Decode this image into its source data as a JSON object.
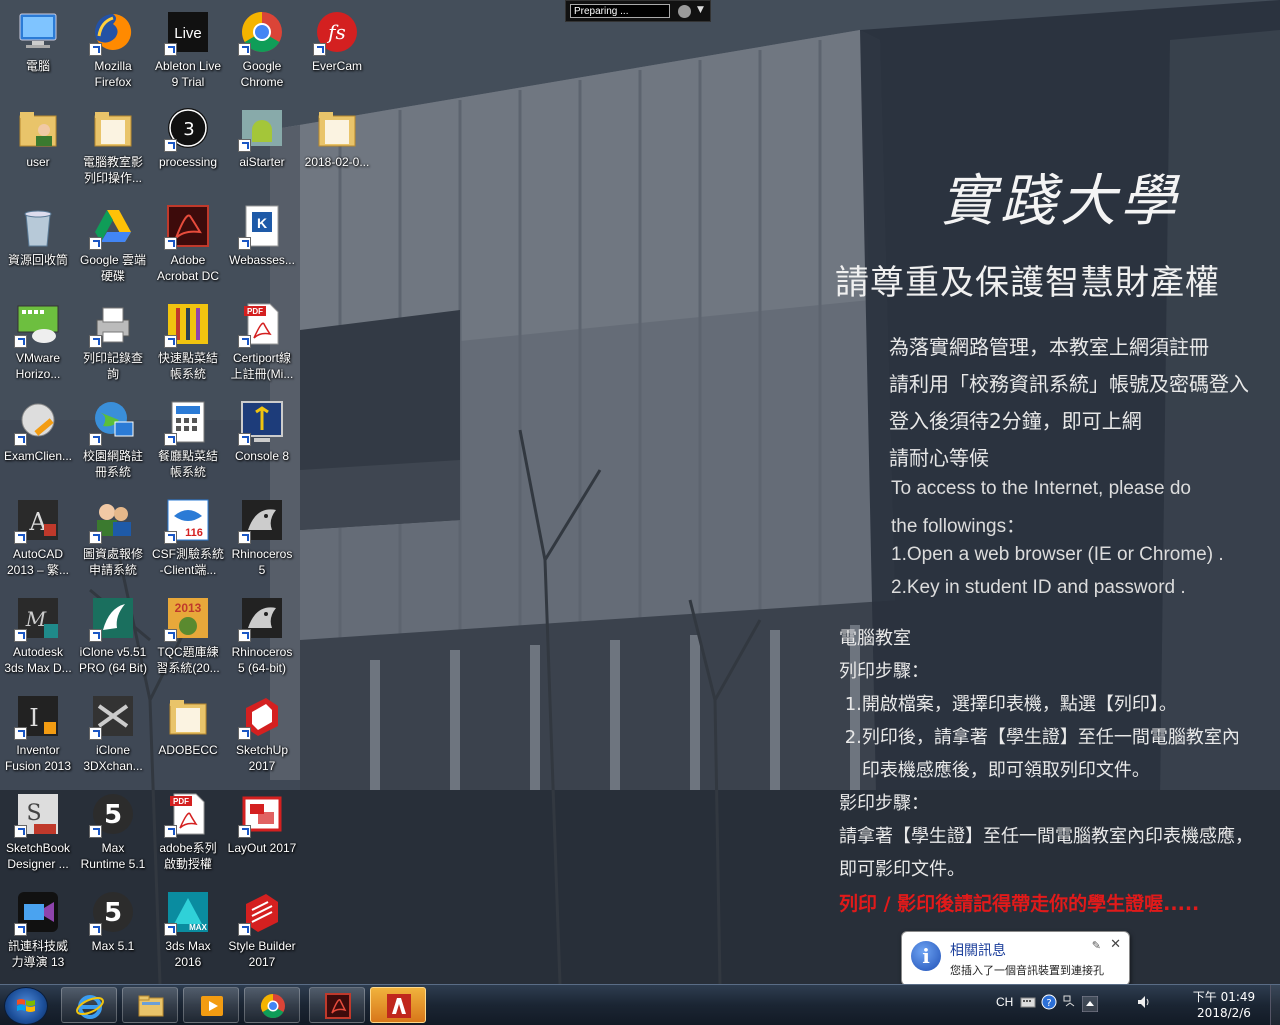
{
  "capture_bar": {
    "status": "Preparing ..."
  },
  "desktop_icons": [
    {
      "label": "電腦",
      "icon": "computer-icon"
    },
    {
      "label": "Mozilla\nFirefox",
      "icon": "firefox-icon"
    },
    {
      "label": "Ableton Live\n9 Trial",
      "icon": "ableton-live-icon"
    },
    {
      "label": "Google\nChrome",
      "icon": "chrome-icon"
    },
    {
      "label": "EverCam",
      "icon": "evercam-icon"
    },
    {
      "label": "user",
      "icon": "user-folder-icon"
    },
    {
      "label": "電腦教室影\n列印操作...",
      "icon": "folder-icon"
    },
    {
      "label": "processing",
      "icon": "processing-icon"
    },
    {
      "label": "aiStarter",
      "icon": "aistarter-icon"
    },
    {
      "label": "2018-02-0...",
      "icon": "folder-icon"
    },
    {
      "label": "資源回收筒",
      "icon": "recycle-bin-icon"
    },
    {
      "label": "Google 雲端\n硬碟",
      "icon": "google-drive-icon"
    },
    {
      "label": "Adobe\nAcrobat DC",
      "icon": "acrobat-icon"
    },
    {
      "label": "Webasses...",
      "icon": "webassessor-icon"
    },
    {
      "label": "VMware\nHorizo...",
      "icon": "vmware-horizon-icon"
    },
    {
      "label": "列印記錄查\n詢",
      "icon": "printer-icon"
    },
    {
      "label": "快速點菜結\n帳系統",
      "icon": "restaurant-icon"
    },
    {
      "label": "Certiport線\n上註冊(Mi...",
      "icon": "pdf-icon"
    },
    {
      "label": "ExamClien...",
      "icon": "exam-client-icon"
    },
    {
      "label": "校園網路註\n冊系統",
      "icon": "network-globe-icon"
    },
    {
      "label": "餐廳點菜結\n帳系統",
      "icon": "calculator-icon"
    },
    {
      "label": "Console 8",
      "icon": "console-icon"
    },
    {
      "label": "AutoCAD\n2013 – 繁...",
      "icon": "autocad-icon"
    },
    {
      "label": "圖資處報修\n申請系統",
      "icon": "users-icon"
    },
    {
      "label": "CSF測驗系統\n-Client端...",
      "icon": "csf-icon"
    },
    {
      "label": "Rhinoceros\n5",
      "icon": "rhino-icon"
    },
    {
      "label": "Autodesk\n3ds Max D...",
      "icon": "3dsmax-design-icon"
    },
    {
      "label": "iClone v5.51\nPRO (64 Bit)",
      "icon": "iclone-icon"
    },
    {
      "label": "TQC題庫練\n習系統(20...",
      "icon": "tqc-icon"
    },
    {
      "label": "Rhinoceros\n5 (64-bit)",
      "icon": "rhino-icon"
    },
    {
      "label": "Inventor\nFusion 2013",
      "icon": "inventor-icon"
    },
    {
      "label": "iClone\n3DXchan...",
      "icon": "3dxchange-icon"
    },
    {
      "label": "ADOBECC",
      "icon": "folder-icon"
    },
    {
      "label": "SketchUp\n2017",
      "icon": "sketchup-icon"
    },
    {
      "label": "SketchBook\nDesigner ...",
      "icon": "sketchbook-icon"
    },
    {
      "label": "Max\nRuntime 5.1",
      "icon": "max-icon"
    },
    {
      "label": "adobe系列\n啟動授權",
      "icon": "pdf-icon"
    },
    {
      "label": "LayOut 2017",
      "icon": "layout-icon"
    },
    {
      "label": "訊連科技威\n力導演 13",
      "icon": "powerdirector-icon"
    },
    {
      "label": "Max 5.1",
      "icon": "max-icon"
    },
    {
      "label": "3ds Max\n2016",
      "icon": "3dsmax-icon"
    },
    {
      "label": "Style Builder\n2017",
      "icon": "style-builder-icon"
    }
  ],
  "wallpaper": {
    "university": "實踐大學",
    "title": "請尊重及保護智慧財產權",
    "lines": [
      "為落實網路管理，本教室上網須註冊",
      "請利用「校務資訊系統」帳號及密碼登入",
      "登入後須待2分鐘，即可上網",
      "請耐心等候"
    ],
    "en_lines": [
      "To access to the Internet, please do",
      " the followings：",
      "1.Open a web browser (IE or Chrome) .",
      "2.Key in student ID and password ."
    ],
    "print_lines": [
      "電腦教室",
      "列印步驟：",
      " 1.開啟檔案，選擇印表機，點選【列印】。",
      " 2.列印後，請拿著【學生證】至任一間電腦教室內",
      "    印表機感應後，即可領取列印文件。",
      "影印步驟：",
      "請拿著【學生證】至任一間電腦教室內印表機感應，",
      "即可影印文件。"
    ],
    "warning": "列印 / 影印後請記得帶走你的學生證喔.....",
    "warning_color": "#e11a1a"
  },
  "balloon": {
    "title": "相關訊息",
    "message": "您插入了一個音訊裝置到連接孔"
  },
  "taskbar": {
    "buttons": [
      "start-button",
      "internet-explorer",
      "windows-explorer",
      "media-player",
      "chrome",
      "acrobat",
      "adobe-cc"
    ],
    "language": "CH",
    "clock_time": "下午 01:49",
    "clock_date": "2018/2/6"
  }
}
